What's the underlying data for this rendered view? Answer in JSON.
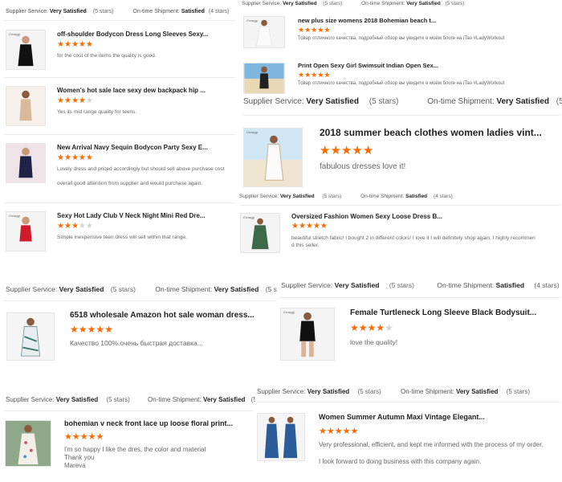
{
  "colors": {
    "star": "#ff6a00",
    "star_off": "#d4d4d4",
    "text": "#222222",
    "muted": "#666666"
  },
  "icons": {
    "star_filled": "star-icon",
    "star_empty": "star-empty-icon"
  },
  "labels": {
    "supplier_service": "Supplier Service:",
    "ontime_shipment": "On-time Shipment:",
    "very_satisfied": "Very Satisfied",
    "satisfied": "Satisfied",
    "five_stars": "(5 stars)",
    "four_stars": "(4 stars)"
  },
  "panels": {
    "p1": {
      "items": [
        {
          "title": "off-shoulder Bodycon Dress Long Sleeves Sexy...",
          "rating": 5,
          "review": "for the cost of the items the quality is good."
        },
        {
          "title": "Women's hot sale lace sexy dew backpack hip ...",
          "rating": 4,
          "review": "Yes its mid range quality for teens."
        },
        {
          "title": "New Arrival Navy Sequin Bodycon Party Sexy E...",
          "rating": 5,
          "review": "Lovely dress and priced accordingly but should sell above purchase cost",
          "review2": "overall good attention from supplier and would purchase again."
        },
        {
          "title": "Sexy Hot Lady Club V Neck Night Mini Red Dre...",
          "rating": 3,
          "review": "Simple inexpensive teen dress will sell within that range."
        }
      ]
    },
    "p2": {
      "items": [
        {
          "title": "new plus size womens 2018 Bohemian beach t...",
          "rating": 5,
          "review": "Товар отличного качества, подробный обзор вы увидите в моём блоге на iTao #LadyWorkout"
        },
        {
          "title": "Print Open Sexy Girl Swimsuit Indian Open Sex...",
          "rating": 5,
          "review": "Товар отличного качества, подробный обзор вы увидите в моём блоге на iTao #LadyWorkout"
        }
      ]
    },
    "p3": {
      "title": "2018 summer beach clothes women ladies vint...",
      "rating": 5,
      "review": "fabulous dresses love it!"
    },
    "p4": {
      "title": "Oversized Fashion Women Sexy Loose Dress B...",
      "rating": 5,
      "review": "beautiful stretch fabric! I bought 2 in different colors! I love it I will definitely shop again, I highly recommen",
      "review2": "d this seller."
    },
    "p5": {
      "title": "6518 wholesale Amazon hot sale woman dress...",
      "rating": 5,
      "review": "Качество 100%.очень быстрая доставка..."
    },
    "p6": {
      "title": "Female Turtleneck Long Sleeve Black Bodysuit...",
      "rating": 4,
      "review": "love the quality!"
    },
    "p7": {
      "title": "bohemian v neck front lace up loose floral print...",
      "rating": 5,
      "review_lines": [
        "I'm so happy I like the dres, the color and material",
        "Thank you",
        "Mareva"
      ]
    },
    "p8": {
      "title": "Women Summer Autumn Maxi Vintage Elegant...",
      "rating": 5,
      "review": "Very professional, efficient, and kept me informed with the process of my order.",
      "review2": "I look forward to doing business with this company again."
    }
  }
}
